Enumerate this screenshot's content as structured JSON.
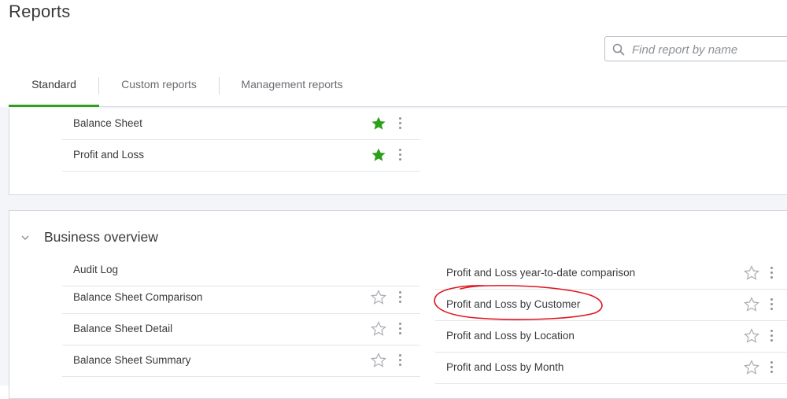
{
  "page": {
    "title": "Reports"
  },
  "search": {
    "placeholder": "Find report by name"
  },
  "tabs": [
    {
      "label": "Standard",
      "active": true
    },
    {
      "label": "Custom reports",
      "active": false
    },
    {
      "label": "Management reports",
      "active": false
    }
  ],
  "favorites": {
    "items": [
      {
        "label": "Balance Sheet",
        "starred": true
      },
      {
        "label": "Profit and Loss",
        "starred": true
      }
    ]
  },
  "business_overview": {
    "title": "Business overview",
    "left_items": [
      {
        "label": "Audit Log",
        "starred": false,
        "has_actions": false
      },
      {
        "label": "Balance Sheet Comparison",
        "starred": false,
        "has_actions": true
      },
      {
        "label": "Balance Sheet Detail",
        "starred": false,
        "has_actions": true
      },
      {
        "label": "Balance Sheet Summary",
        "starred": false,
        "has_actions": true
      }
    ],
    "right_items": [
      {
        "label": "Profit and Loss year-to-date comparison",
        "starred": false
      },
      {
        "label": "Profit and Loss by Customer",
        "starred": false,
        "circled": true
      },
      {
        "label": "Profit and Loss by Location",
        "starred": false
      },
      {
        "label": "Profit and Loss by Month",
        "starred": false
      }
    ]
  },
  "colors": {
    "accent_green": "#2ca01c",
    "star_filled": "#2ca01c",
    "annotation_red": "#e0141e",
    "text": "#393a3d",
    "panel_bg": "#f4f5f8"
  },
  "icons": {
    "search": "search-icon",
    "star_filled": "star-filled-icon",
    "star_outline": "star-outline-icon",
    "more": "kebab-menu-icon",
    "collapse": "chevron-down-icon"
  }
}
